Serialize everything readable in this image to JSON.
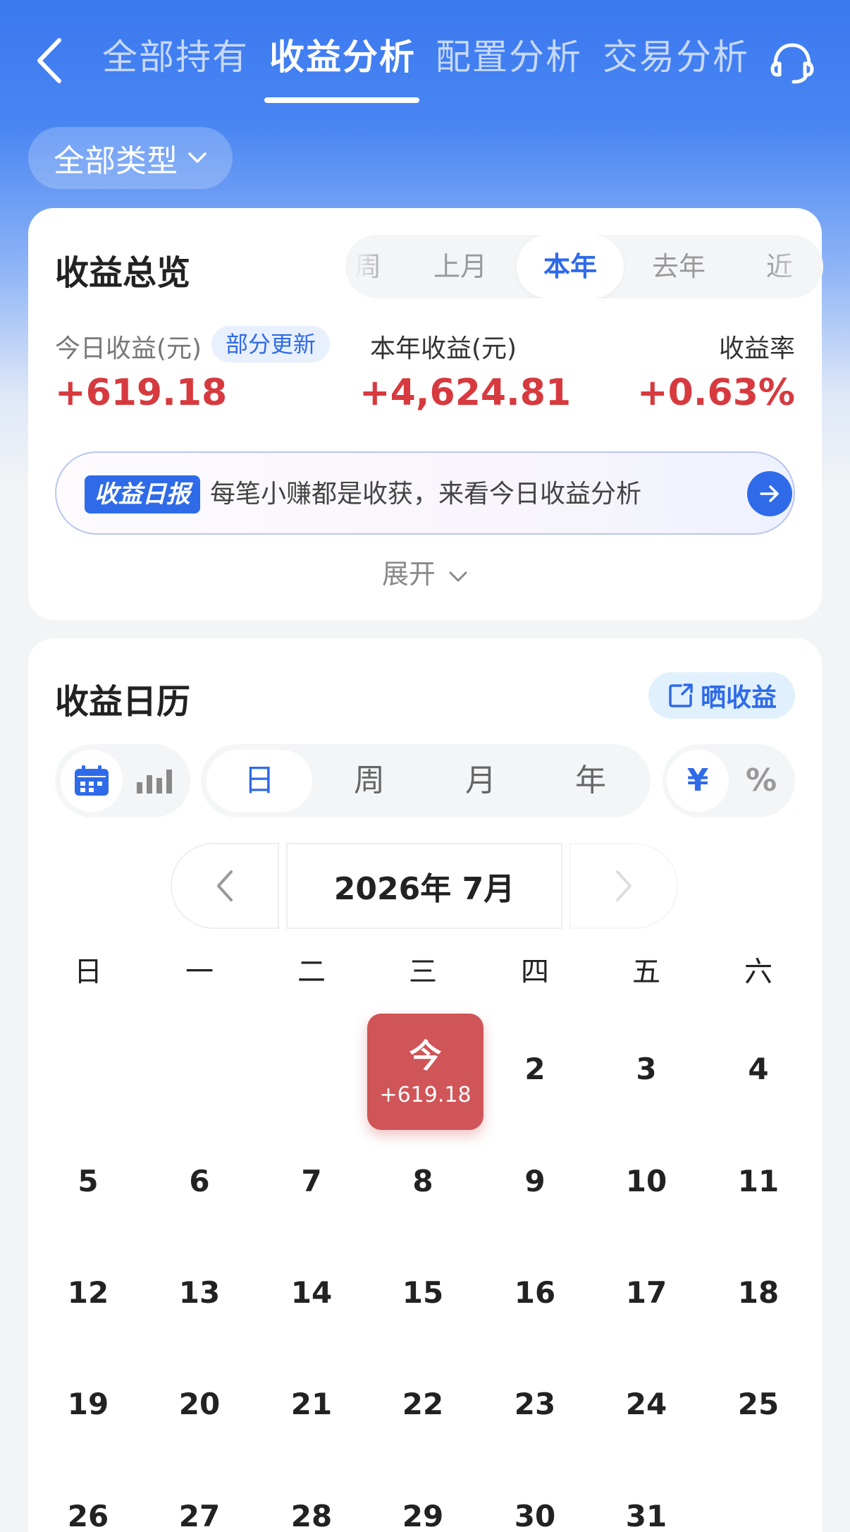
{
  "header": {
    "tabs": [
      {
        "label": "全部持有"
      },
      {
        "label": "收益分析"
      },
      {
        "label": "配置分析"
      },
      {
        "label": "交易分析"
      }
    ],
    "active_tab": "收益分析"
  },
  "filter": {
    "type_label": "全部类型"
  },
  "overview": {
    "title": "收益总览",
    "periods": [
      {
        "label": "周"
      },
      {
        "label": "上月"
      },
      {
        "label": "本年"
      },
      {
        "label": "去年"
      },
      {
        "label": "近"
      }
    ],
    "active_period": "本年",
    "today": {
      "label": "今日收益(元)",
      "badge": "部分更新",
      "value": "+619.18"
    },
    "year": {
      "label": "本年收益(元)",
      "value": "+4,624.81"
    },
    "rate": {
      "label": "收益率",
      "value": "+0.63%"
    },
    "report": {
      "tag": "收益日报",
      "text": "每笔小赚都是收获，来看今日收益分析"
    },
    "expand_label": "展开"
  },
  "calendar": {
    "title": "收益日历",
    "share_label": "晒收益",
    "granularity": [
      {
        "label": "日"
      },
      {
        "label": "周"
      },
      {
        "label": "月"
      },
      {
        "label": "年"
      }
    ],
    "active_granularity": "日",
    "units": [
      {
        "label": "¥"
      },
      {
        "label": "%"
      }
    ],
    "active_unit": "¥",
    "month_label": "2026年 7月",
    "weekdays": [
      "日",
      "一",
      "二",
      "三",
      "四",
      "五",
      "六"
    ],
    "today": {
      "label": "今",
      "value": "+619.18"
    },
    "days": [
      "2",
      "3",
      "4",
      "5",
      "6",
      "7",
      "8",
      "9",
      "10",
      "11",
      "12",
      "13",
      "14",
      "15",
      "16",
      "17",
      "18",
      "19",
      "20",
      "21",
      "22",
      "23",
      "24",
      "25",
      "26",
      "27",
      "28",
      "29",
      "30",
      "31"
    ]
  },
  "colors": {
    "accent": "#2f6be8",
    "gain": "#d63a3f",
    "today_bg": "#d05558"
  }
}
